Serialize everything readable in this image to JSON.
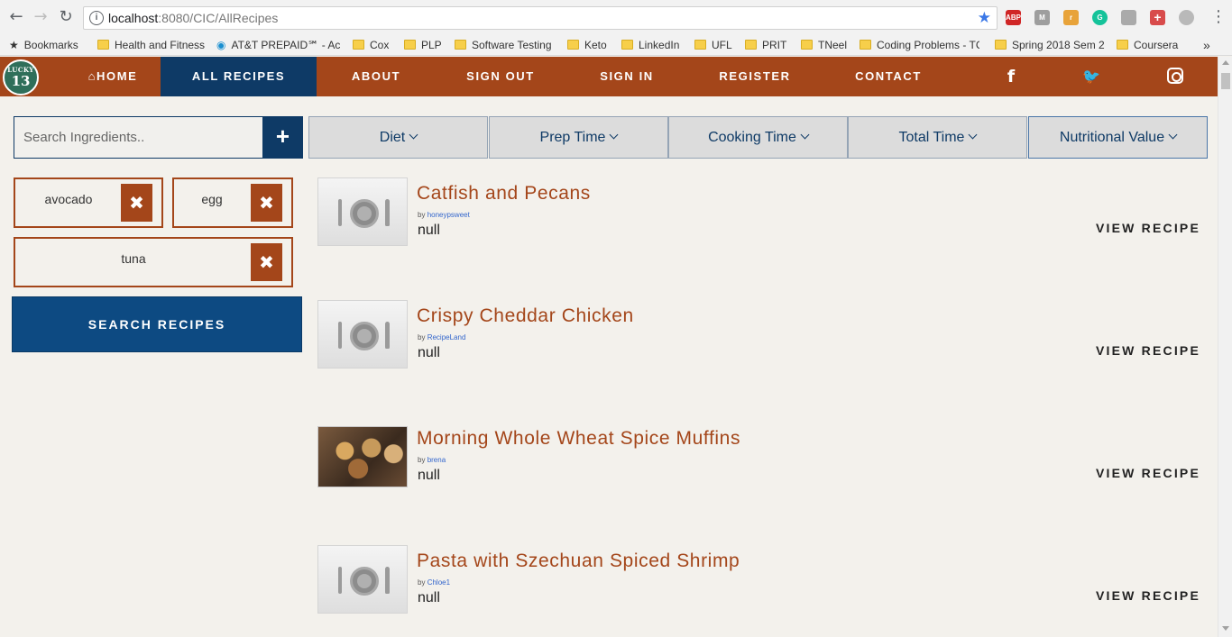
{
  "browser": {
    "url_host": "localhost",
    "url_rest": ":8080/CIC/AllRecipes",
    "extensions": [
      {
        "name": "adblock-icon",
        "label": "ABP",
        "color": "#d02626"
      },
      {
        "name": "m-extension-icon",
        "label": "M",
        "color": "#9e9e9e"
      },
      {
        "name": "r-extension-icon",
        "label": "r",
        "color": "#e8a33a"
      },
      {
        "name": "grammarly-icon",
        "label": "G",
        "color": "#15c39a"
      },
      {
        "name": "puzzle-extension-icon",
        "label": "",
        "color": "#aaaaaa"
      },
      {
        "name": "cross-extension-icon",
        "label": "+",
        "color": "#d84b4b"
      },
      {
        "name": "gear-extension-icon",
        "label": "",
        "color": "#b9b9b9"
      }
    ],
    "bookmarks": [
      {
        "label": "Bookmarks",
        "kind": "star"
      },
      {
        "label": "Health and Fitness",
        "kind": "folder"
      },
      {
        "label": "AT&T PREPAID℠ - Ac",
        "kind": "globe"
      },
      {
        "label": "Cox",
        "kind": "folder"
      },
      {
        "label": "PLP",
        "kind": "folder"
      },
      {
        "label": "Software Testing",
        "kind": "folder"
      },
      {
        "label": "Keto",
        "kind": "folder"
      },
      {
        "label": "LinkedIn",
        "kind": "folder"
      },
      {
        "label": "UFL",
        "kind": "folder"
      },
      {
        "label": "PRIT",
        "kind": "folder"
      },
      {
        "label": "TNeel",
        "kind": "folder"
      },
      {
        "label": "Coding Problems - TC",
        "kind": "folder"
      },
      {
        "label": "Spring 2018 Sem 2",
        "kind": "folder"
      },
      {
        "label": "Coursera",
        "kind": "folder"
      }
    ],
    "more": "»"
  },
  "logo": {
    "line1": "LUCKY",
    "line2": "13"
  },
  "nav": {
    "home": "HOME",
    "all_recipes": "ALL RECIPES",
    "about": "ABOUT",
    "sign_out": "SIGN OUT",
    "sign_in": "SIGN IN",
    "register": "REGISTER",
    "contact": "CONTACT",
    "facebook": "f",
    "twitter": "🐦"
  },
  "search": {
    "placeholder": "Search Ingredients..",
    "add": "+",
    "ingredients": [
      "avocado",
      "egg",
      "tuna"
    ],
    "remove": "✖",
    "submit": "SEARCH RECIPES"
  },
  "filters": [
    "Diet",
    "Prep Time",
    "Cooking Time",
    "Total Time",
    "Nutritional Value"
  ],
  "recipes": [
    {
      "title": "Catfish and Pecans",
      "by": "by",
      "author": "honeypsweet",
      "desc": "null",
      "action": "VIEW RECIPE"
    },
    {
      "title": "Crispy Cheddar Chicken",
      "by": "by",
      "author": "RecipeLand",
      "desc": "null",
      "action": "VIEW RECIPE"
    },
    {
      "title": "Morning Whole Wheat Spice Muffins",
      "by": "by",
      "author": "brena",
      "desc": "null",
      "action": "VIEW RECIPE"
    },
    {
      "title": "Pasta with Szechuan Spiced Shrimp",
      "by": "by",
      "author": "Chloe1",
      "desc": "null",
      "action": "VIEW RECIPE"
    }
  ],
  "colors": {
    "brand_rust": "#a4461a",
    "brand_navy": "#0e3a66",
    "search_button": "#0d4a82",
    "page_bg": "#f3f1ec"
  }
}
